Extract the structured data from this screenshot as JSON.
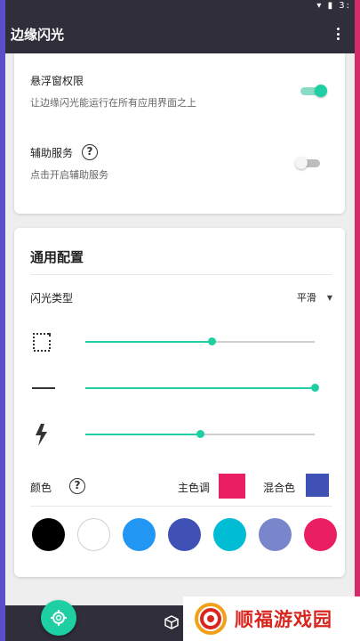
{
  "app_bar": {
    "title": "边缘闪光",
    "menu_icon": "more-vert-icon"
  },
  "status_bar": {
    "icons": "▾ ▮ 3:"
  },
  "permissions": {
    "overlay": {
      "title": "悬浮窗权限",
      "subtitle": "让边缘闪光能运行在所有应用界面之上",
      "enabled": true
    },
    "accessibility": {
      "title": "辅助服务",
      "subtitle": "点击开启辅助服务",
      "help_icon": "?",
      "enabled": false
    }
  },
  "general": {
    "section_title": "通用配置",
    "flash_type": {
      "label": "闪光类型",
      "selected": "平滑",
      "arrow": "▼"
    },
    "sliders": [
      {
        "icon": "border-corner-icon",
        "value": 0.55
      },
      {
        "icon": "line-width-icon",
        "value": 1.0
      },
      {
        "icon": "lightning-icon",
        "value": 0.5
      }
    ],
    "color": {
      "label": "颜色",
      "help_icon": "?",
      "main_tone_label": "主色调",
      "main_tone_color": "#e91e63",
      "mix_label": "混合色",
      "mix_color": "#3f51b5"
    },
    "palette": [
      "#000000",
      "#ffffff",
      "#2196f3",
      "#3f51b5",
      "#00bcd4",
      "#7986cb",
      "#e91e63"
    ]
  },
  "colors": {
    "accent": "#1dcfa3",
    "app_bar": "#2f2e3a"
  },
  "watermark": {
    "text": "顺福游戏园"
  }
}
